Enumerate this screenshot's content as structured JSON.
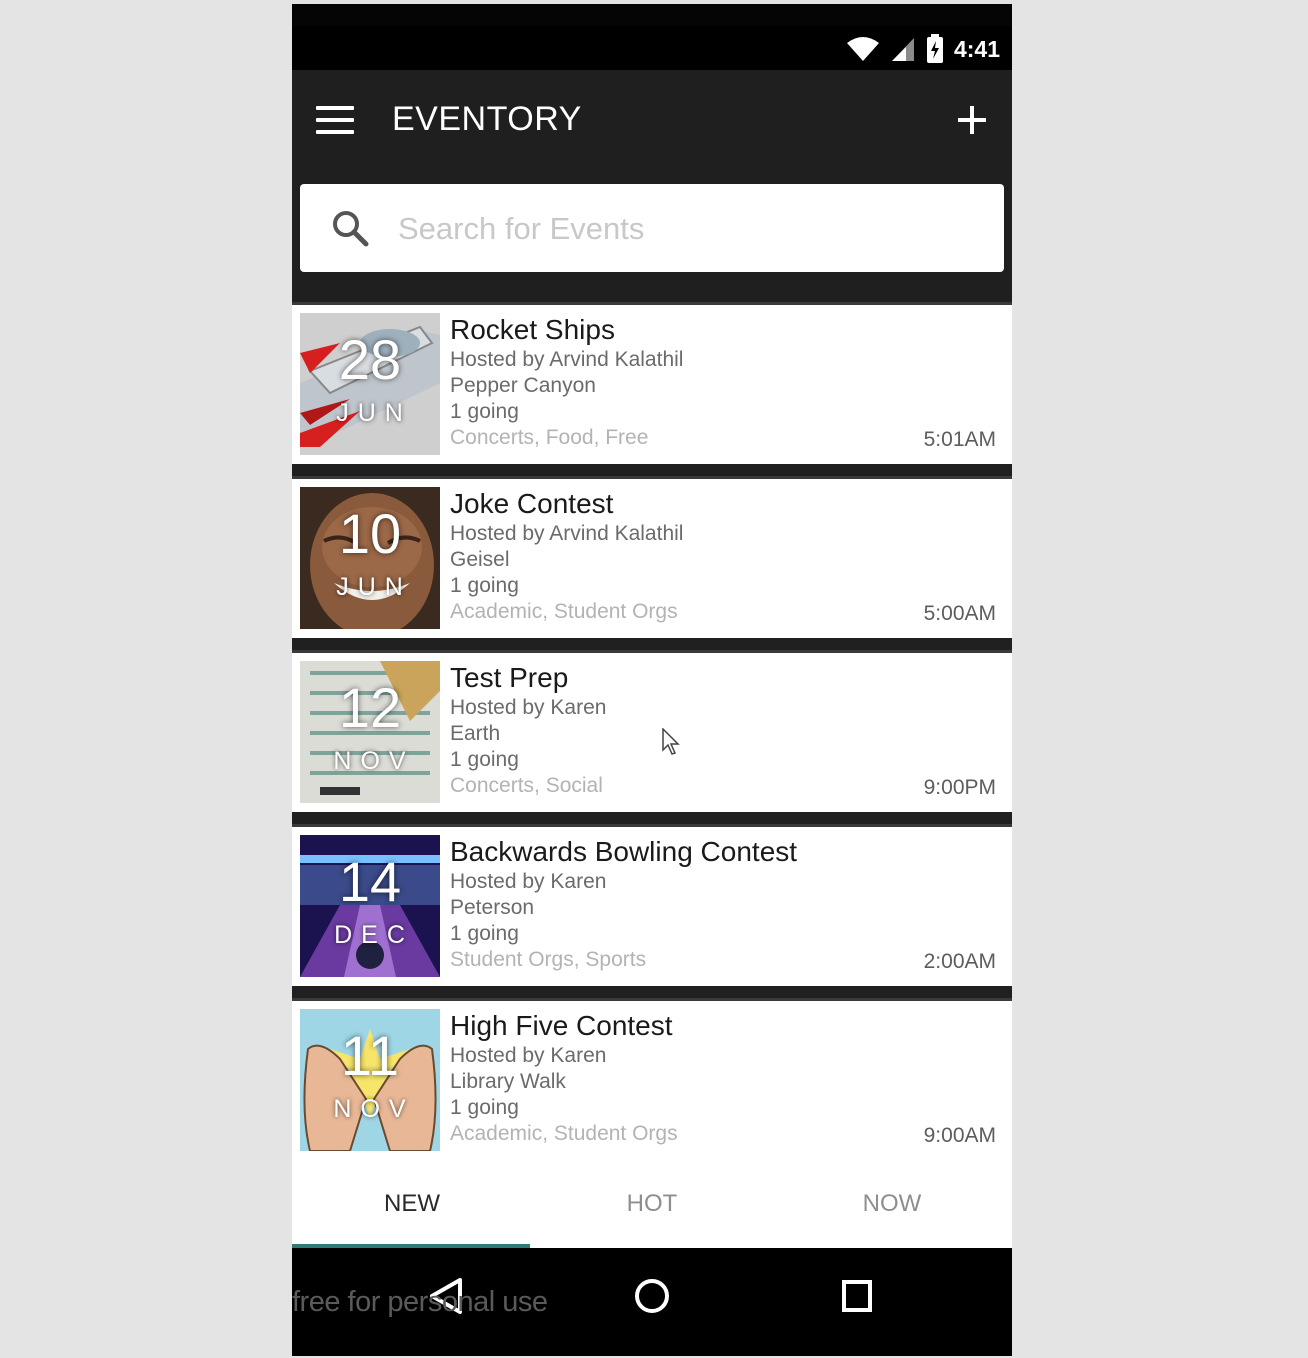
{
  "status_bar": {
    "time": "4:41",
    "icons": [
      "wifi-icon",
      "signal-icon",
      "battery-icon"
    ]
  },
  "app_bar": {
    "title": "EVENTORY",
    "menu_icon": "menu-icon",
    "add_icon": "add-icon"
  },
  "search": {
    "placeholder": "Search for Events",
    "value": "",
    "icon": "search-icon"
  },
  "events": [
    {
      "day": "28",
      "month": "JUN",
      "title": "Rocket Ships",
      "host": "Hosted by Arvind Kalathil",
      "location": "Pepper Canyon",
      "going": "1 going",
      "tags": "Concerts, Food, Free",
      "time": "5:01AM",
      "image": "rocket-image"
    },
    {
      "day": "10",
      "month": "JUN",
      "title": "Joke Contest",
      "host": "Hosted by Arvind Kalathil",
      "location": "Geisel",
      "going": "1 going",
      "tags": "Academic, Student Orgs",
      "time": "5:00AM",
      "image": "laughing-man-image"
    },
    {
      "day": "12",
      "month": "NOV",
      "title": "Test Prep",
      "host": "Hosted by Karen",
      "location": "Earth",
      "going": "1 going",
      "tags": "Concerts, Social",
      "time": "9:00PM",
      "image": "answer-sheet-image"
    },
    {
      "day": "14",
      "month": "DEC",
      "title": "Backwards Bowling Contest",
      "host": "Hosted by Karen",
      "location": "Peterson",
      "going": "1 going",
      "tags": "Student Orgs, Sports",
      "time": "2:00AM",
      "image": "bowling-alley-image"
    },
    {
      "day": "11",
      "month": "NOV",
      "title": "High Five Contest",
      "host": "Hosted by Karen",
      "location": "Library Walk",
      "going": "1 going",
      "tags": "Academic, Student Orgs",
      "time": "9:00AM",
      "image": "high-five-image"
    }
  ],
  "tabs": [
    {
      "label": "NEW",
      "active": true
    },
    {
      "label": "HOT",
      "active": false
    },
    {
      "label": "NOW",
      "active": false
    }
  ],
  "nav_bar": {
    "buttons": [
      "back-icon",
      "home-icon",
      "recents-icon"
    ]
  },
  "watermark": "free for personal use",
  "colors": {
    "app_bar": "#1f1f1f",
    "tab_indicator": "#2e7b78",
    "card_bg": "#ffffff",
    "placeholder": "#c8c8c8"
  }
}
